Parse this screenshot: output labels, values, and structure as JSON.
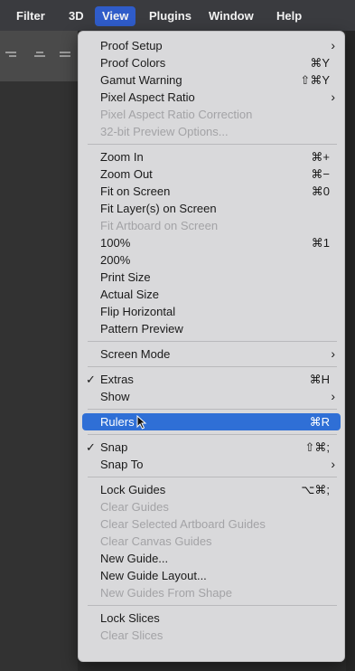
{
  "menubar": {
    "items": [
      "Filter",
      "3D",
      "View",
      "Plugins",
      "Window",
      "Help"
    ],
    "active": "View"
  },
  "view_menu": {
    "groups": [
      [
        {
          "label": "Proof Setup",
          "shortcut": "",
          "submenu": true,
          "disabled": false
        },
        {
          "label": "Proof Colors",
          "shortcut": "⌘Y",
          "submenu": false,
          "disabled": false
        },
        {
          "label": "Gamut Warning",
          "shortcut": "⇧⌘Y",
          "submenu": false,
          "disabled": false
        },
        {
          "label": "Pixel Aspect Ratio",
          "shortcut": "",
          "submenu": true,
          "disabled": false
        },
        {
          "label": "Pixel Aspect Ratio Correction",
          "shortcut": "",
          "submenu": false,
          "disabled": true
        },
        {
          "label": "32-bit Preview Options...",
          "shortcut": "",
          "submenu": false,
          "disabled": true
        }
      ],
      [
        {
          "label": "Zoom In",
          "shortcut": "⌘+",
          "submenu": false,
          "disabled": false
        },
        {
          "label": "Zoom Out",
          "shortcut": "⌘−",
          "submenu": false,
          "disabled": false
        },
        {
          "label": "Fit on Screen",
          "shortcut": "⌘0",
          "submenu": false,
          "disabled": false
        },
        {
          "label": "Fit Layer(s) on Screen",
          "shortcut": "",
          "submenu": false,
          "disabled": false
        },
        {
          "label": "Fit Artboard on Screen",
          "shortcut": "",
          "submenu": false,
          "disabled": true
        },
        {
          "label": "100%",
          "shortcut": "⌘1",
          "submenu": false,
          "disabled": false
        },
        {
          "label": "200%",
          "shortcut": "",
          "submenu": false,
          "disabled": false
        },
        {
          "label": "Print Size",
          "shortcut": "",
          "submenu": false,
          "disabled": false
        },
        {
          "label": "Actual Size",
          "shortcut": "",
          "submenu": false,
          "disabled": false
        },
        {
          "label": "Flip Horizontal",
          "shortcut": "",
          "submenu": false,
          "disabled": false
        },
        {
          "label": "Pattern Preview",
          "shortcut": "",
          "submenu": false,
          "disabled": false
        }
      ],
      [
        {
          "label": "Screen Mode",
          "shortcut": "",
          "submenu": true,
          "disabled": false
        }
      ],
      [
        {
          "label": "Extras",
          "shortcut": "⌘H",
          "submenu": false,
          "disabled": false,
          "checked": true
        },
        {
          "label": "Show",
          "shortcut": "",
          "submenu": true,
          "disabled": false
        }
      ],
      [
        {
          "label": "Rulers",
          "shortcut": "⌘R",
          "submenu": false,
          "disabled": false,
          "highlighted": true
        }
      ],
      [
        {
          "label": "Snap",
          "shortcut": "⇧⌘;",
          "submenu": false,
          "disabled": false,
          "checked": true
        },
        {
          "label": "Snap To",
          "shortcut": "",
          "submenu": true,
          "disabled": false
        }
      ],
      [
        {
          "label": "Lock Guides",
          "shortcut": "⌥⌘;",
          "submenu": false,
          "disabled": false
        },
        {
          "label": "Clear Guides",
          "shortcut": "",
          "submenu": false,
          "disabled": true
        },
        {
          "label": "Clear Selected Artboard Guides",
          "shortcut": "",
          "submenu": false,
          "disabled": true
        },
        {
          "label": "Clear Canvas Guides",
          "shortcut": "",
          "submenu": false,
          "disabled": true
        },
        {
          "label": "New Guide...",
          "shortcut": "",
          "submenu": false,
          "disabled": false
        },
        {
          "label": "New Guide Layout...",
          "shortcut": "",
          "submenu": false,
          "disabled": false
        },
        {
          "label": "New Guides From Shape",
          "shortcut": "",
          "submenu": false,
          "disabled": true
        }
      ],
      [
        {
          "label": "Lock Slices",
          "shortcut": "",
          "submenu": false,
          "disabled": false
        },
        {
          "label": "Clear Slices",
          "shortcut": "",
          "submenu": false,
          "disabled": true
        }
      ]
    ]
  },
  "colors": {
    "menubar_bg": "#3a3b3f",
    "menu_bg": "#d9d9db",
    "highlight": "#2f6fd6",
    "disabled_text": "#a3a3a6"
  },
  "icons": [
    "align-right-icon",
    "align-center-icon",
    "align-justify-icon",
    "mouse-pointer-icon",
    "chevron-right-icon",
    "checkmark-icon"
  ]
}
